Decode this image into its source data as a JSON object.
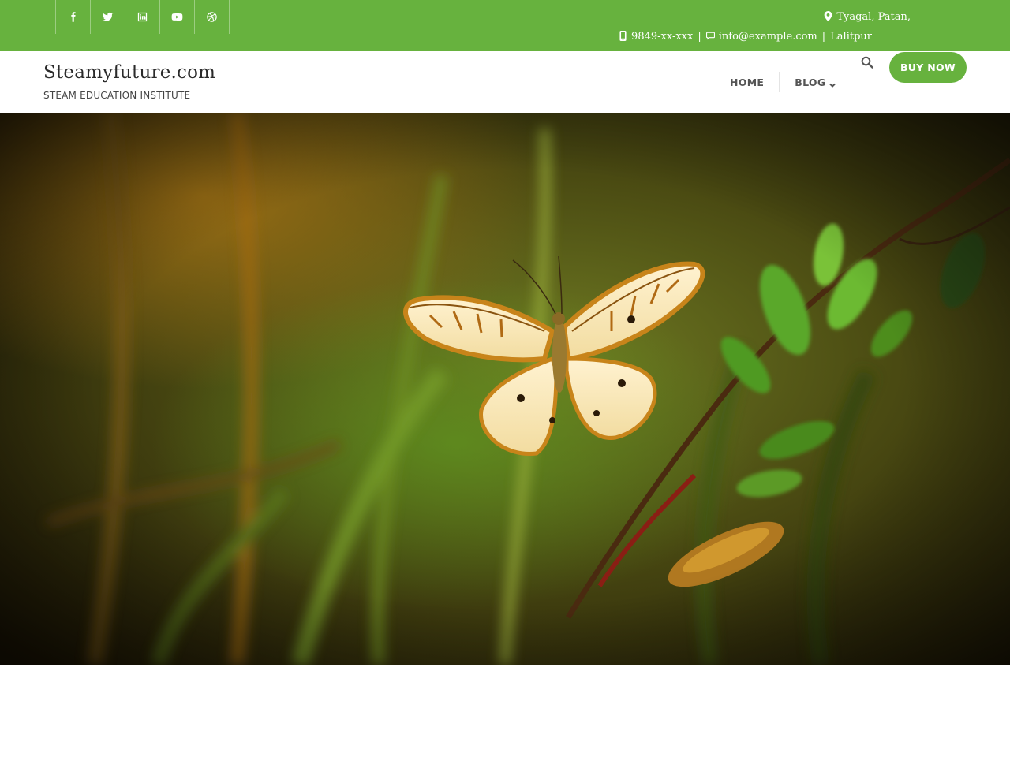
{
  "topbar": {
    "social": [
      {
        "name": "facebook-icon"
      },
      {
        "name": "twitter-icon"
      },
      {
        "name": "linkedin-icon"
      },
      {
        "name": "youtube-icon"
      },
      {
        "name": "dribbble-icon"
      }
    ],
    "address": "Tyagal, Patan,",
    "phone": "9849-xx-xxx",
    "email": "info@example.com",
    "city": "Lalitpur",
    "separator": "|"
  },
  "header": {
    "site_title": "Steamyfuture.com",
    "tagline": "STEAM EDUCATION INSTITUTE",
    "nav": [
      {
        "label": "HOME"
      },
      {
        "label": "BLOG"
      }
    ],
    "buy_label": "BUY NOW"
  },
  "hero": {
    "image": "butterfly-on-plant-photo"
  },
  "colors": {
    "brand_green": "#67b23e",
    "text_dark": "#2b2b2b",
    "nav_text": "#555555"
  }
}
